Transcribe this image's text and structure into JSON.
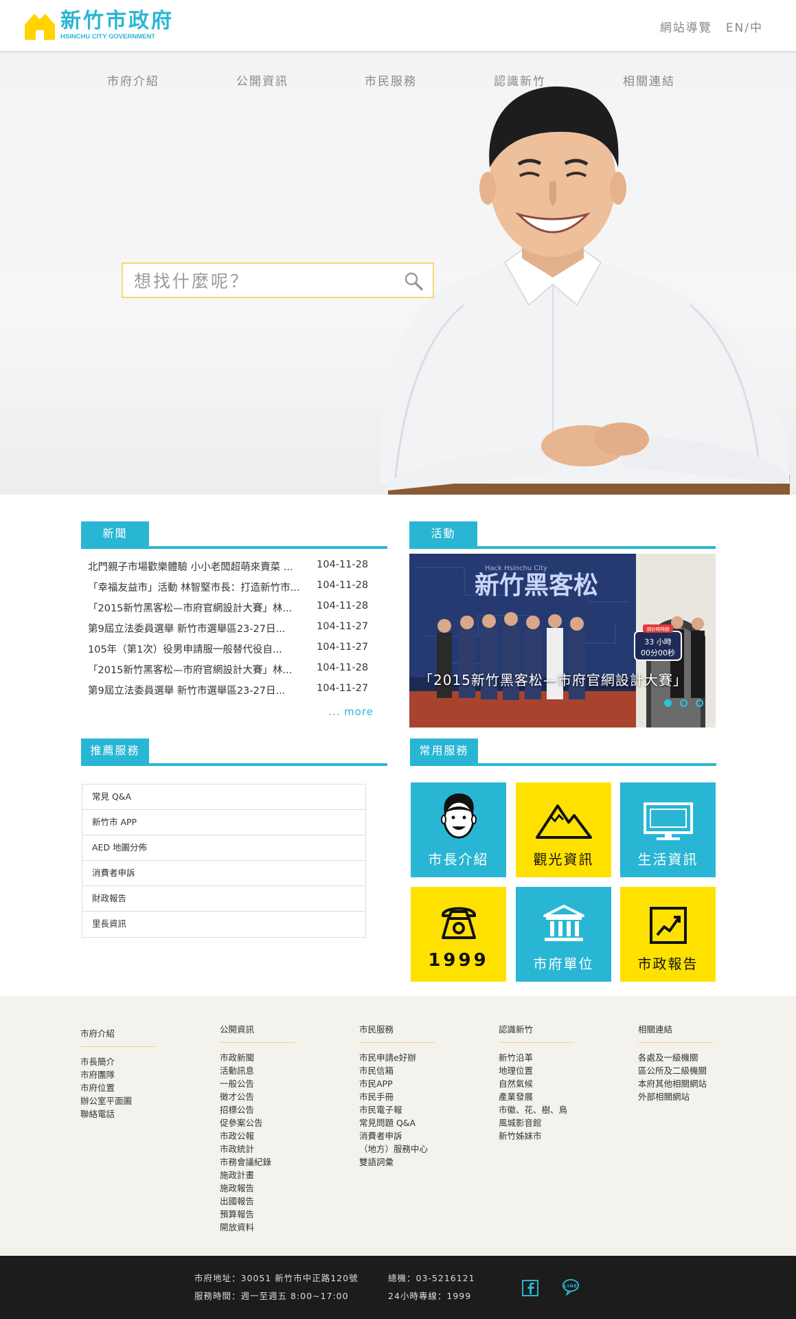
{
  "header": {
    "logo_title": "新竹市政府",
    "logo_sub": "HSINCHU CITY GOVERNMENT",
    "sitemap": "網站導覽",
    "language": "EN/中"
  },
  "nav": [
    "市府介紹",
    "公開資訊",
    "市民服務",
    "認識新竹",
    "相關連結"
  ],
  "search": {
    "placeholder": "想找什麼呢？"
  },
  "news": {
    "title": "新聞",
    "items": [
      {
        "title": "北門親子市場歡樂體驗 小小老闆超萌來賣菜 ...",
        "date": "104-11-28"
      },
      {
        "title": "「幸福友益市」活動 林智堅市長：打造新竹市...",
        "date": "104-11-28"
      },
      {
        "title": "「2015新竹黑客松—市府官網設計大賽」林...",
        "date": "104-11-28"
      },
      {
        "title": "第9屆立法委員選舉 新竹市選舉區23-27日...",
        "date": "104-11-27"
      },
      {
        "title": "105年（第1次）役男申請服一般替代役自...",
        "date": "104-11-27"
      },
      {
        "title": "「2015新竹黑客松—市府官網設計大賽」林...",
        "date": "104-11-28"
      },
      {
        "title": "第9屆立法委員選舉 新竹市選舉區23-27日...",
        "date": "104-11-27"
      }
    ],
    "more": "... more"
  },
  "activity": {
    "title": "活動",
    "caption": "「2015新竹黑客松—市府官網設計大賽」",
    "banner_text": "新竹黑客松",
    "banner_sub": "Hack Hsinchu City",
    "timer_top": "倒計時時間",
    "timer_line1": "33 小時",
    "timer_line2": "00分00秒"
  },
  "recommended": {
    "title": "推薦服務",
    "items": [
      "常見 Q&A",
      "新竹市 APP",
      "AED 地圖分佈",
      "消費者申訴",
      "財政報告",
      "里長資訊"
    ]
  },
  "common": {
    "title": "常用服務",
    "tiles": [
      {
        "label": "市長介紹",
        "icon": "mayor-face-icon",
        "color": "blue"
      },
      {
        "label": "觀光資訊",
        "icon": "mountain-icon",
        "color": "yellow"
      },
      {
        "label": "生活資訊",
        "icon": "monitor-icon",
        "color": "blue"
      },
      {
        "label": "1999",
        "icon": "telephone-icon",
        "color": "yellow"
      },
      {
        "label": "市府單位",
        "icon": "government-building-icon",
        "color": "blue"
      },
      {
        "label": "市政報告",
        "icon": "trend-chart-icon",
        "color": "yellow"
      }
    ]
  },
  "footer": {
    "columns": [
      {
        "title": "市府介紹",
        "items": [
          "市長簡介",
          "市府團隊",
          "市府位置",
          "辦公室平面圖",
          "聯絡電話"
        ]
      },
      {
        "title": "公開資訊",
        "items": [
          "市政新聞",
          "活動訊息",
          "一般公告",
          "徵才公告",
          "招標公告",
          "促參案公告",
          "市政公報",
          "市政統計",
          "市務會議紀錄",
          "施政計畫",
          "施政報告",
          "出國報告",
          "預算報告",
          "開放資料"
        ]
      },
      {
        "title": "市民服務",
        "items": [
          "市民申請e好辦",
          "市民信箱",
          "市民APP",
          "市民手冊",
          "市民電子報",
          "常見問題 Q&A",
          "消費者申訴",
          "（地方）服務中心",
          "雙語詞彙"
        ]
      },
      {
        "title": "認識新竹",
        "items": [
          "新竹沿革",
          "地理位置",
          "自然氣候",
          "產業發展",
          "市徽、花、樹、鳥",
          "風城影音館",
          "新竹姊妹市"
        ]
      },
      {
        "title": "相關連結",
        "items": [
          "各處及一級機關",
          "區公所及二級機關",
          "本府其他相關網站",
          "外部相關網站"
        ]
      }
    ]
  },
  "bottom": {
    "address": "市府地址：30051 新竹市中正路120號",
    "hours": "服務時間：週一至週五  8:00~17:00",
    "phone": "總機：03-5216121",
    "hotline": "24小時專線：1999"
  },
  "colors": {
    "accent": "#29b6d4",
    "yellow": "#ffe100",
    "footer_bg": "#f4f2ed",
    "bottom_bg": "#1c1c1c"
  }
}
